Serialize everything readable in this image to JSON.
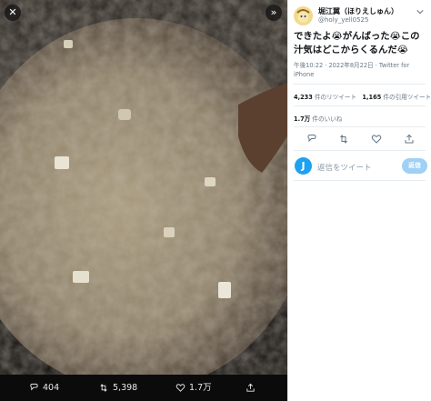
{
  "viewer": {
    "photo_description_icon": "food-photo",
    "close_icon": "close-icon",
    "expand_icon": "chevron-double-right-icon",
    "actions": {
      "reply_count": "404",
      "retweet_count": "5,398",
      "like_count": "1.7万"
    }
  },
  "tweet": {
    "display_name": "堀江翼（ほりえしゅん）",
    "handle": "@holy_yell0525",
    "text": "できたよ😭がんばった😭この汁気はどこからくるんだ😭",
    "time": "午後10:22 · 2022年8月22日 · Twitter for iPhone",
    "retweets_value": "4,233",
    "retweets_label": "件のリツイート",
    "quotes_value": "1,165",
    "quotes_label": "件の引用ツイート",
    "likes_value": "1.7万",
    "likes_label": "件のいいね"
  },
  "reply": {
    "avatar_letter": "J",
    "placeholder": "返信をツイート",
    "button_label": "返信"
  },
  "colors": {
    "accent": "#1da1f2",
    "reply_button": "#9fd0f5",
    "muted_text": "#657786"
  }
}
